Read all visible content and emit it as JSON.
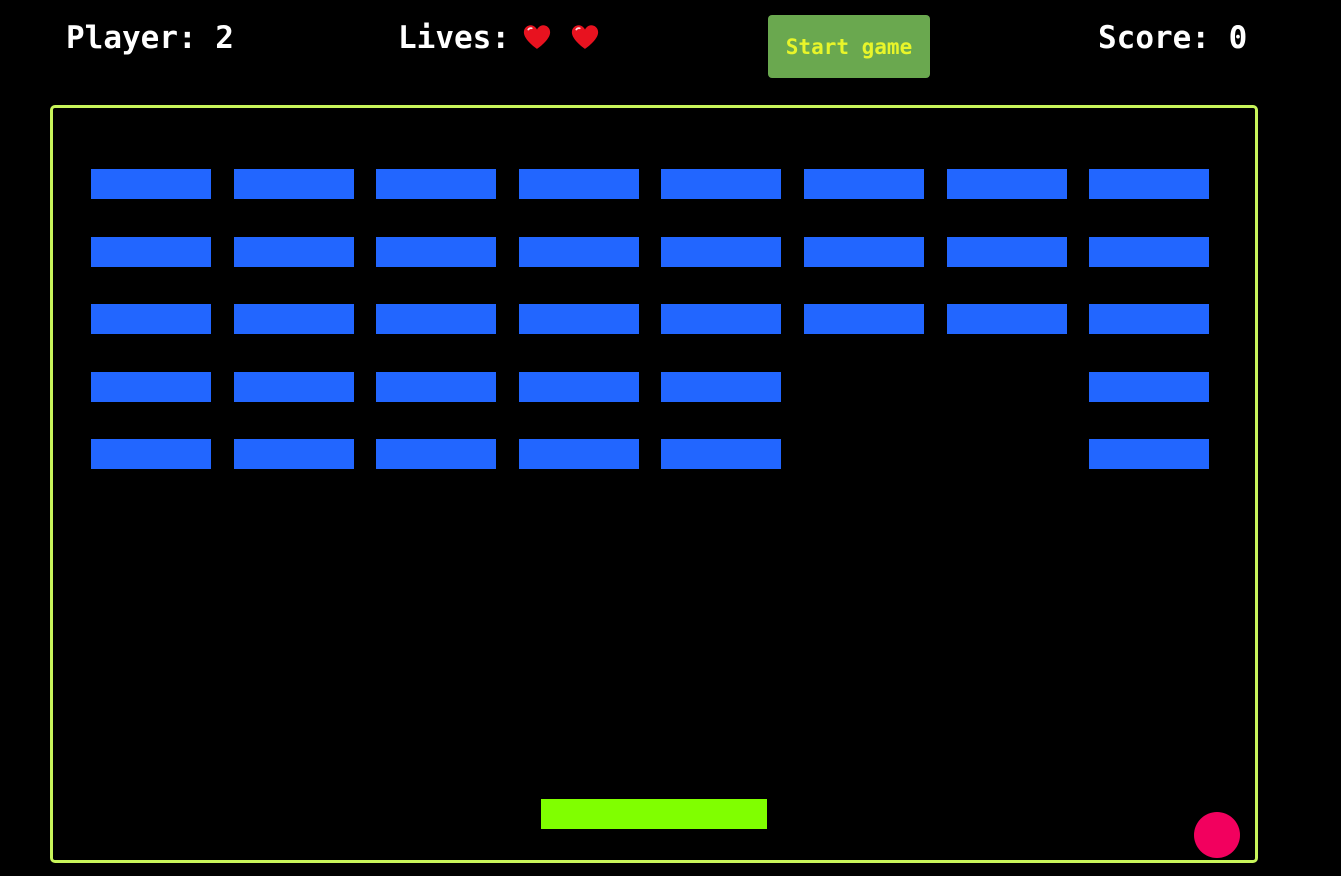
{
  "hud": {
    "player_text": "Player: 2",
    "lives_label": "Lives:",
    "lives_count": 2,
    "score_text": "Score: 0",
    "heart_icon": "heart-icon"
  },
  "controls": {
    "start_label": "Start game"
  },
  "board": {
    "rows": 5,
    "cols": 8,
    "bricks": [
      [
        true,
        true,
        true,
        true,
        true,
        true,
        true,
        true
      ],
      [
        true,
        true,
        true,
        true,
        true,
        true,
        true,
        true
      ],
      [
        true,
        true,
        true,
        true,
        true,
        true,
        true,
        true
      ],
      [
        true,
        true,
        true,
        true,
        true,
        false,
        false,
        true
      ],
      [
        true,
        true,
        true,
        true,
        true,
        false,
        false,
        true
      ]
    ]
  },
  "colors": {
    "background": "#000000",
    "hud_text": "#ffffff",
    "heart": "#e8121f",
    "button_bg": "#6aa84f",
    "button_text": "#e8f52a",
    "board_border": "#c8f55a",
    "brick": "#2266ff",
    "paddle": "#80ff00",
    "ball": "#f2005e"
  }
}
